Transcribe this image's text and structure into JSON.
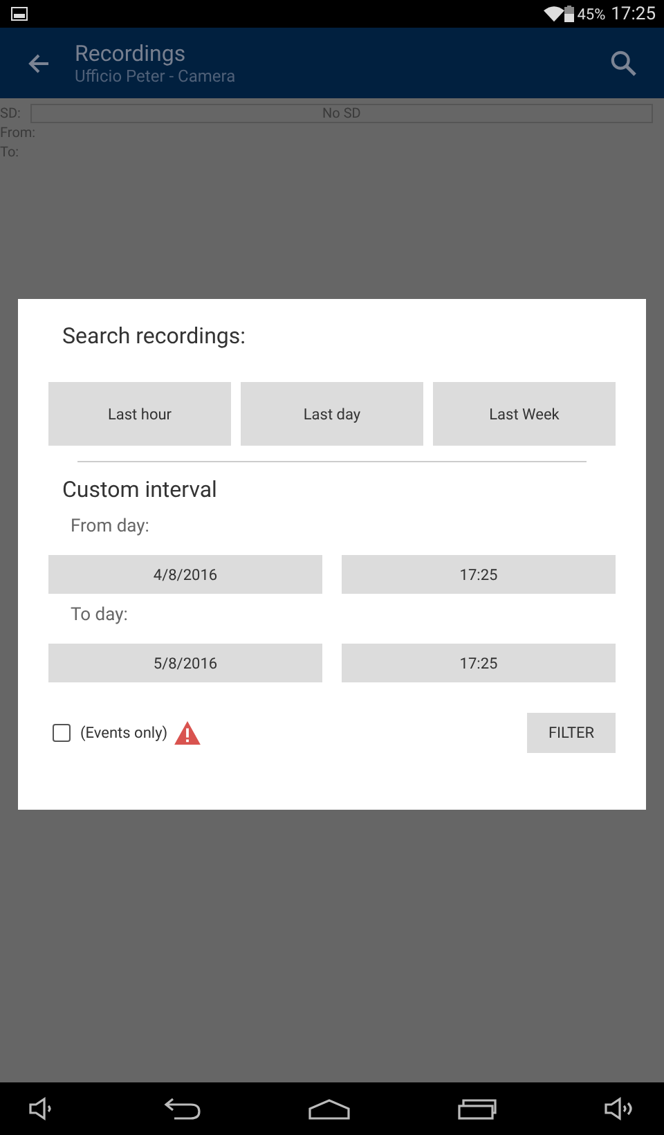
{
  "status_bar": {
    "battery": "45%",
    "time": "17:25"
  },
  "app_bar": {
    "title": "Recordings",
    "subtitle": "Ufficio Peter - Camera"
  },
  "info": {
    "sd_label": "SD:",
    "sd_value": "No SD",
    "from_label": "From:",
    "to_label": "To:"
  },
  "dialog": {
    "title": "Search recordings:",
    "quick_buttons": [
      "Last hour",
      "Last day",
      "Last Week"
    ],
    "custom_title": "Custom interval",
    "from_label": "From day:",
    "from_date": "4/8/2016",
    "from_time": "17:25",
    "to_label": "To day:",
    "to_date": "5/8/2016",
    "to_time": "17:25",
    "events_only": {
      "label": "(Events only)",
      "checked": false
    },
    "filter_button": "FILTER"
  }
}
